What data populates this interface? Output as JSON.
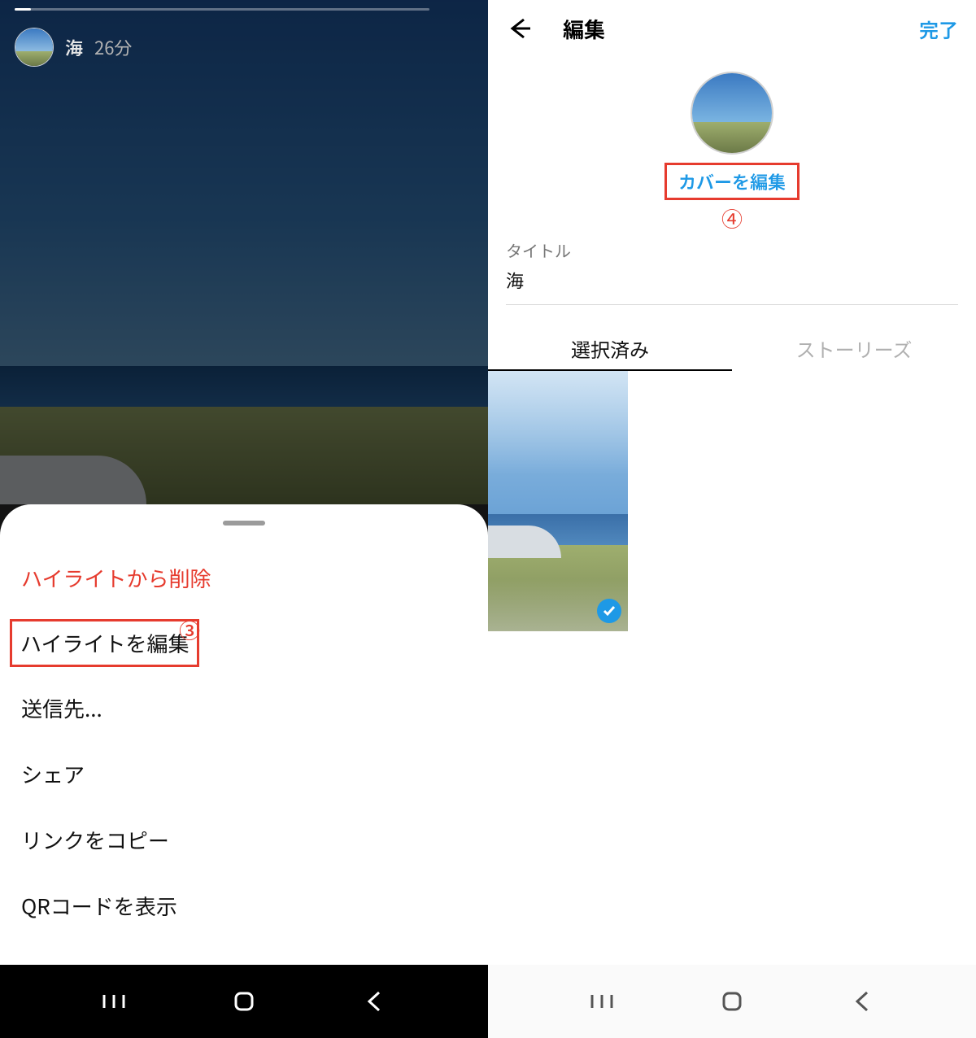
{
  "left": {
    "story_title": "海",
    "story_time": "26分",
    "sheet": {
      "items": [
        {
          "label": "ハイライトから削除",
          "danger": true
        },
        {
          "label": "ハイライトを編集",
          "hl": true
        },
        {
          "label": "送信先...",
          "danger": false
        },
        {
          "label": "シェア",
          "danger": false
        },
        {
          "label": "リンクをコピー",
          "danger": false
        },
        {
          "label": "QRコードを表示",
          "danger": false
        }
      ]
    },
    "annot_3": "③"
  },
  "right": {
    "header": {
      "title": "編集",
      "done": "完了"
    },
    "cover_link": "カバーを編集",
    "annot_4": "④",
    "title_label": "タイトル",
    "title_value": "海",
    "tabs": {
      "selected": "選択済み",
      "stories": "ストーリーズ"
    }
  }
}
